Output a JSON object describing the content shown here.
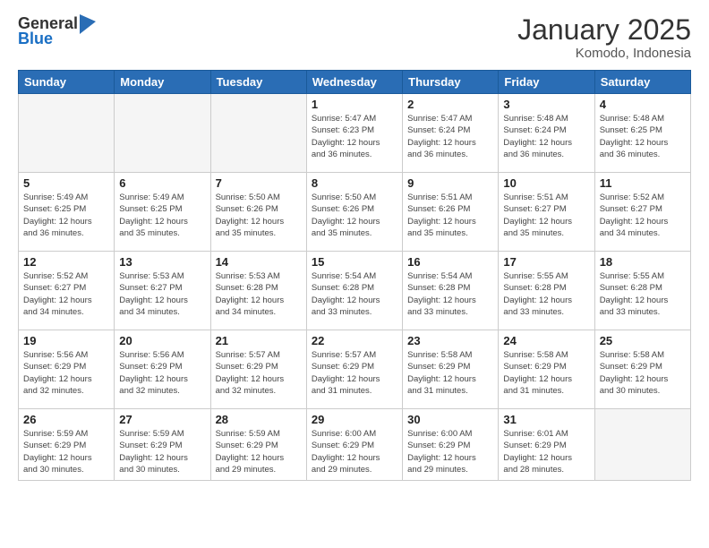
{
  "logo": {
    "general": "General",
    "blue": "Blue"
  },
  "title": "January 2025",
  "subtitle": "Komodo, Indonesia",
  "days_of_week": [
    "Sunday",
    "Monday",
    "Tuesday",
    "Wednesday",
    "Thursday",
    "Friday",
    "Saturday"
  ],
  "weeks": [
    [
      {
        "day": "",
        "info": ""
      },
      {
        "day": "",
        "info": ""
      },
      {
        "day": "",
        "info": ""
      },
      {
        "day": "1",
        "info": "Sunrise: 5:47 AM\nSunset: 6:23 PM\nDaylight: 12 hours\nand 36 minutes."
      },
      {
        "day": "2",
        "info": "Sunrise: 5:47 AM\nSunset: 6:24 PM\nDaylight: 12 hours\nand 36 minutes."
      },
      {
        "day": "3",
        "info": "Sunrise: 5:48 AM\nSunset: 6:24 PM\nDaylight: 12 hours\nand 36 minutes."
      },
      {
        "day": "4",
        "info": "Sunrise: 5:48 AM\nSunset: 6:25 PM\nDaylight: 12 hours\nand 36 minutes."
      }
    ],
    [
      {
        "day": "5",
        "info": "Sunrise: 5:49 AM\nSunset: 6:25 PM\nDaylight: 12 hours\nand 36 minutes."
      },
      {
        "day": "6",
        "info": "Sunrise: 5:49 AM\nSunset: 6:25 PM\nDaylight: 12 hours\nand 35 minutes."
      },
      {
        "day": "7",
        "info": "Sunrise: 5:50 AM\nSunset: 6:26 PM\nDaylight: 12 hours\nand 35 minutes."
      },
      {
        "day": "8",
        "info": "Sunrise: 5:50 AM\nSunset: 6:26 PM\nDaylight: 12 hours\nand 35 minutes."
      },
      {
        "day": "9",
        "info": "Sunrise: 5:51 AM\nSunset: 6:26 PM\nDaylight: 12 hours\nand 35 minutes."
      },
      {
        "day": "10",
        "info": "Sunrise: 5:51 AM\nSunset: 6:27 PM\nDaylight: 12 hours\nand 35 minutes."
      },
      {
        "day": "11",
        "info": "Sunrise: 5:52 AM\nSunset: 6:27 PM\nDaylight: 12 hours\nand 34 minutes."
      }
    ],
    [
      {
        "day": "12",
        "info": "Sunrise: 5:52 AM\nSunset: 6:27 PM\nDaylight: 12 hours\nand 34 minutes."
      },
      {
        "day": "13",
        "info": "Sunrise: 5:53 AM\nSunset: 6:27 PM\nDaylight: 12 hours\nand 34 minutes."
      },
      {
        "day": "14",
        "info": "Sunrise: 5:53 AM\nSunset: 6:28 PM\nDaylight: 12 hours\nand 34 minutes."
      },
      {
        "day": "15",
        "info": "Sunrise: 5:54 AM\nSunset: 6:28 PM\nDaylight: 12 hours\nand 33 minutes."
      },
      {
        "day": "16",
        "info": "Sunrise: 5:54 AM\nSunset: 6:28 PM\nDaylight: 12 hours\nand 33 minutes."
      },
      {
        "day": "17",
        "info": "Sunrise: 5:55 AM\nSunset: 6:28 PM\nDaylight: 12 hours\nand 33 minutes."
      },
      {
        "day": "18",
        "info": "Sunrise: 5:55 AM\nSunset: 6:28 PM\nDaylight: 12 hours\nand 33 minutes."
      }
    ],
    [
      {
        "day": "19",
        "info": "Sunrise: 5:56 AM\nSunset: 6:29 PM\nDaylight: 12 hours\nand 32 minutes."
      },
      {
        "day": "20",
        "info": "Sunrise: 5:56 AM\nSunset: 6:29 PM\nDaylight: 12 hours\nand 32 minutes."
      },
      {
        "day": "21",
        "info": "Sunrise: 5:57 AM\nSunset: 6:29 PM\nDaylight: 12 hours\nand 32 minutes."
      },
      {
        "day": "22",
        "info": "Sunrise: 5:57 AM\nSunset: 6:29 PM\nDaylight: 12 hours\nand 31 minutes."
      },
      {
        "day": "23",
        "info": "Sunrise: 5:58 AM\nSunset: 6:29 PM\nDaylight: 12 hours\nand 31 minutes."
      },
      {
        "day": "24",
        "info": "Sunrise: 5:58 AM\nSunset: 6:29 PM\nDaylight: 12 hours\nand 31 minutes."
      },
      {
        "day": "25",
        "info": "Sunrise: 5:58 AM\nSunset: 6:29 PM\nDaylight: 12 hours\nand 30 minutes."
      }
    ],
    [
      {
        "day": "26",
        "info": "Sunrise: 5:59 AM\nSunset: 6:29 PM\nDaylight: 12 hours\nand 30 minutes."
      },
      {
        "day": "27",
        "info": "Sunrise: 5:59 AM\nSunset: 6:29 PM\nDaylight: 12 hours\nand 30 minutes."
      },
      {
        "day": "28",
        "info": "Sunrise: 5:59 AM\nSunset: 6:29 PM\nDaylight: 12 hours\nand 29 minutes."
      },
      {
        "day": "29",
        "info": "Sunrise: 6:00 AM\nSunset: 6:29 PM\nDaylight: 12 hours\nand 29 minutes."
      },
      {
        "day": "30",
        "info": "Sunrise: 6:00 AM\nSunset: 6:29 PM\nDaylight: 12 hours\nand 29 minutes."
      },
      {
        "day": "31",
        "info": "Sunrise: 6:01 AM\nSunset: 6:29 PM\nDaylight: 12 hours\nand 28 minutes."
      },
      {
        "day": "",
        "info": ""
      }
    ]
  ]
}
